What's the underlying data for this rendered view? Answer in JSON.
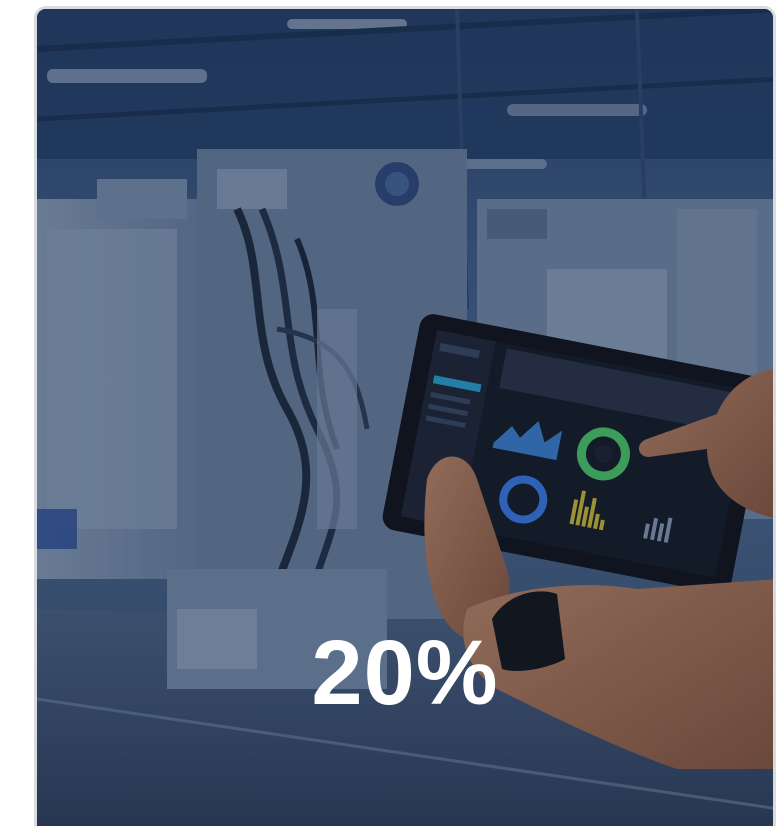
{
  "stat": {
    "value": "20%"
  },
  "image": {
    "description_icon": "factory-tablet-photo"
  },
  "colors": {
    "overlay": "#1e2d4a",
    "text": "#ffffff"
  }
}
